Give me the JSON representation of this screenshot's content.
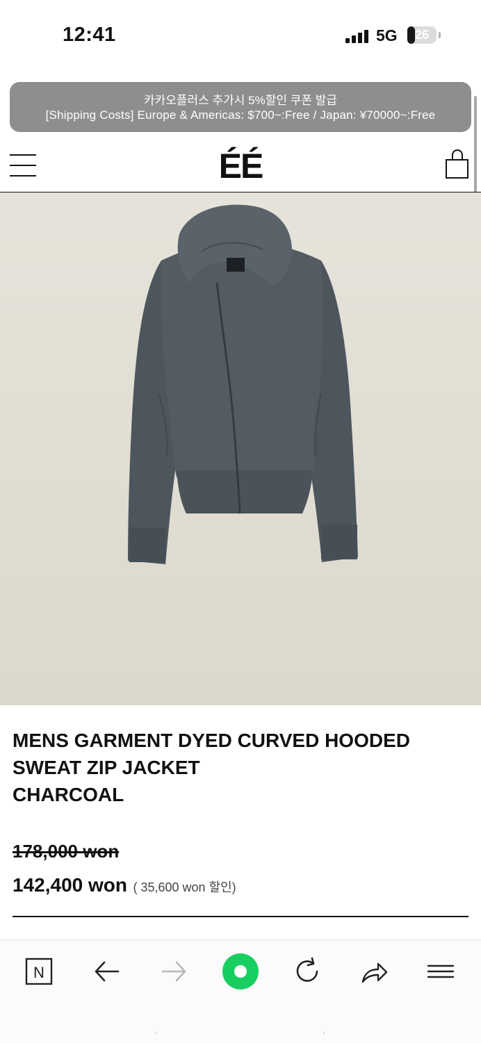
{
  "status_bar": {
    "time": "12:41",
    "network": "5G",
    "battery": "26",
    "battery_level": 0.26
  },
  "announcement": {
    "line1": "카카오플러스 추가시 5%할인 쿠폰 발급",
    "line2": "[Shipping Costs] Europe & Americas: $700~:Free / Japan: ¥70000~:Free"
  },
  "header": {
    "logo": "ÉÉ",
    "menu_icon": "hamburger-menu-icon",
    "cart_icon": "shopping-bag-icon"
  },
  "product": {
    "title_lines": [
      "MENS GARMENT DYED CURVED HOODED",
      "SWEAT ZIP JACKET",
      "CHARCOAL"
    ],
    "image_label": "product-photo",
    "original_price": "178,000 won",
    "sale_price": "142,400 won",
    "discount_note": "( 35,600 won 할인)"
  },
  "browser_toolbar": {
    "buttons": [
      {
        "icon": "naver-n-icon",
        "label": "N"
      },
      {
        "icon": "back-arrow-icon"
      },
      {
        "icon": "forward-arrow-icon"
      },
      {
        "icon": "green-circle-home-icon"
      },
      {
        "icon": "refresh-icon"
      },
      {
        "icon": "share-icon"
      },
      {
        "icon": "menu-icon"
      }
    ],
    "accent_color": "#19ce60"
  },
  "colors": {
    "announcement_bg": "#8e8e8e",
    "image_bg": "#e4e1d7",
    "jacket": "#4f585f"
  }
}
